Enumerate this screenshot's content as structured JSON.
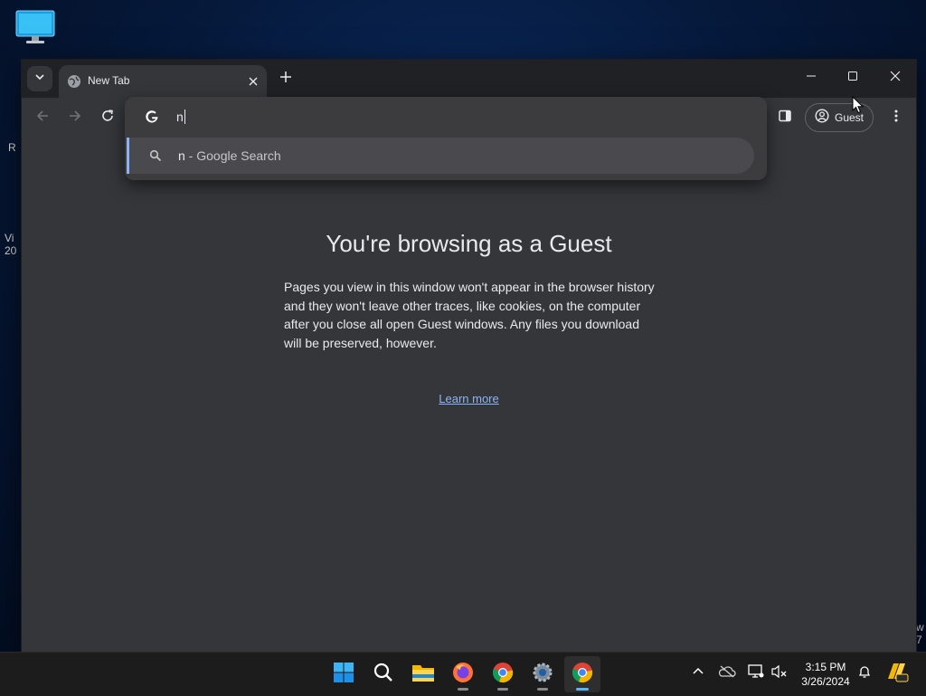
{
  "desktop": {
    "icon": "monitor-icon",
    "fragments": [
      "R",
      "Vi",
      "20",
      "w",
      "7"
    ]
  },
  "browser": {
    "tab": {
      "title": "New Tab",
      "favicon": "globe-icon"
    },
    "window_controls": [
      "minimize-icon",
      "maximize-icon",
      "close-icon"
    ],
    "toolbar": {
      "back": "back-arrow-icon",
      "forward": "forward-arrow-icon",
      "reload": "reload-icon",
      "side_panel": "side-panel-icon",
      "profile_label": "Guest",
      "menu": "kebab-menu-icon"
    },
    "omnibox": {
      "search_engine_icon": "google-g-icon",
      "value": "n",
      "suggestion": {
        "query": "n",
        "suffix": " - Google Search",
        "icon": "search-icon"
      }
    }
  },
  "page": {
    "title": "You're browsing as a Guest",
    "description": "Pages you view in this window won't appear in the browser history and they won't leave other traces, like cookies, on the computer after you close all open Guest windows. Any files you download will be preserved, however.",
    "learn_more": "Learn more"
  },
  "taskbar": {
    "apps": [
      "start-icon",
      "search-icon",
      "file-explorer-icon",
      "firefox-icon",
      "chrome-icon",
      "settings-icon",
      "chrome-icon"
    ],
    "clock": {
      "time": "3:15 PM",
      "date": "3/26/2024"
    },
    "tray": [
      "chevron-up-icon",
      "onedrive-icon",
      "display-icon",
      "volume-muted-icon",
      "bell-icon",
      "copilot-icon"
    ]
  },
  "colors": {
    "accent": "#8ab4f8",
    "window_bg": "#35363a",
    "titlebar_bg": "#202124",
    "taskbar_bg": "#1c1c1c"
  }
}
